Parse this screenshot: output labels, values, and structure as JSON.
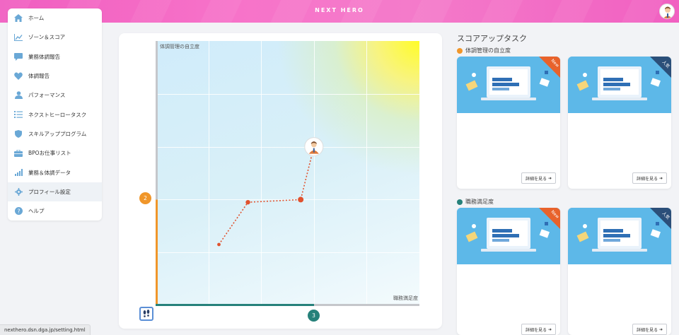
{
  "header": {
    "brand": "NEXT HERO"
  },
  "sidebar": {
    "items": [
      {
        "label": "ホーム",
        "icon": "home-icon"
      },
      {
        "label": "ゾーン＆スコア",
        "icon": "chart-line-icon"
      },
      {
        "label": "業務体調報告",
        "icon": "comment-icon"
      },
      {
        "label": "体調報告",
        "icon": "heart-icon"
      },
      {
        "label": "パフォーマンス",
        "icon": "user-icon"
      },
      {
        "label": "ネクストヒーロータスク",
        "icon": "list-icon"
      },
      {
        "label": "スキルアッププログラム",
        "icon": "shield-icon"
      },
      {
        "label": "BPOお仕事リスト",
        "icon": "briefcase-icon"
      },
      {
        "label": "業務＆体調データ",
        "icon": "bar-chart-icon"
      },
      {
        "label": "プロフィール設定",
        "icon": "gear-icon"
      },
      {
        "label": "ヘルプ",
        "icon": "help-icon"
      }
    ],
    "active_index": 9
  },
  "chart": {
    "ylabel": "体調管理の自立度",
    "xlabel": "職務満足度",
    "y_badge": "2",
    "x_badge": "3"
  },
  "chart_data": {
    "type": "line",
    "x": [
      1.2,
      1.75,
      2.75,
      3.0
    ],
    "y": [
      1.15,
      1.95,
      2.0,
      3.0
    ],
    "xlim": [
      0,
      5
    ],
    "ylim": [
      0,
      5
    ],
    "xlabel": "職務満足度",
    "ylabel": "体調管理の自立度",
    "grid": true,
    "current": {
      "x": 3,
      "y": 2
    }
  },
  "tasks": {
    "title": "スコアアップタスク",
    "sections": [
      {
        "label": "体調管理の自立度",
        "color": "#f0962a",
        "cards": [
          {
            "badge": "New",
            "badge_color": "#e8622b",
            "button": "詳細を見る"
          },
          {
            "badge": "人気",
            "badge_color": "#2b4f79",
            "button": "詳細を見る"
          }
        ]
      },
      {
        "label": "職務満足度",
        "color": "#26817a",
        "cards": [
          {
            "badge": "New",
            "badge_color": "#e8622b",
            "button": "詳細を見る"
          },
          {
            "badge": "人気",
            "badge_color": "#2b4f79",
            "button": "詳細を見る"
          }
        ]
      }
    ]
  },
  "statusbar": {
    "url": "nexthero.dsn.dga.jp/setting.html"
  }
}
